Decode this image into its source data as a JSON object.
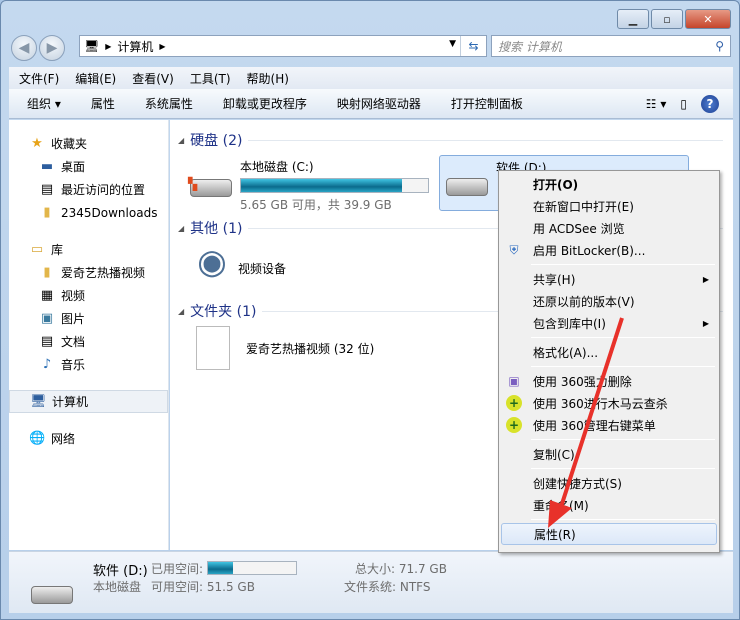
{
  "address": {
    "path": [
      "计算机"
    ],
    "search_placeholder": "搜索 计算机"
  },
  "menu": [
    "文件(F)",
    "编辑(E)",
    "查看(V)",
    "工具(T)",
    "帮助(H)"
  ],
  "toolbar": [
    "组织 ▾",
    "属性",
    "系统属性",
    "卸载或更改程序",
    "映射网络驱动器",
    "打开控制面板"
  ],
  "sidebar": {
    "favorites": {
      "label": "收藏夹",
      "items": [
        "桌面",
        "最近访问的位置",
        "2345Downloads"
      ]
    },
    "library": {
      "label": "库",
      "items": [
        "爱奇艺热播视频",
        "视频",
        "图片",
        "文档",
        "音乐"
      ]
    },
    "computer": "计算机",
    "network": "网络"
  },
  "groups": {
    "disks": {
      "label": "硬盘 (2)",
      "c": {
        "name": "本地磁盘 (C:)",
        "info": "5.65 GB 可用，共 39.9 GB",
        "used_percent": 86
      },
      "d": {
        "name": "软件 (D:)"
      }
    },
    "other": {
      "label": "其他 (1)",
      "item": "视频设备"
    },
    "folders": {
      "label": "文件夹 (1)",
      "item": "爱奇艺热播视频 (32 位)"
    }
  },
  "context_menu": [
    "打开(O)",
    "在新窗口中打开(E)",
    "用 ACDSee 浏览",
    "启用 BitLocker(B)...",
    "共享(H)",
    "还原以前的版本(V)",
    "包含到库中(I)",
    "格式化(A)...",
    "使用 360强力删除",
    "使用 360进行木马云查杀",
    "使用 360管理右键菜单",
    "复制(C)",
    "创建快捷方式(S)",
    "重命名(M)",
    "属性(R)"
  ],
  "status": {
    "name": "软件 (D:)",
    "used_label": "已用空间:",
    "used_percent": 28,
    "type": "本地磁盘",
    "free": "可用空间: 51.5 GB",
    "total": "总大小: 71.7 GB",
    "fs": "文件系统: NTFS"
  },
  "colors": {
    "accent": "#1e3287",
    "arrow": "#e8312a"
  }
}
